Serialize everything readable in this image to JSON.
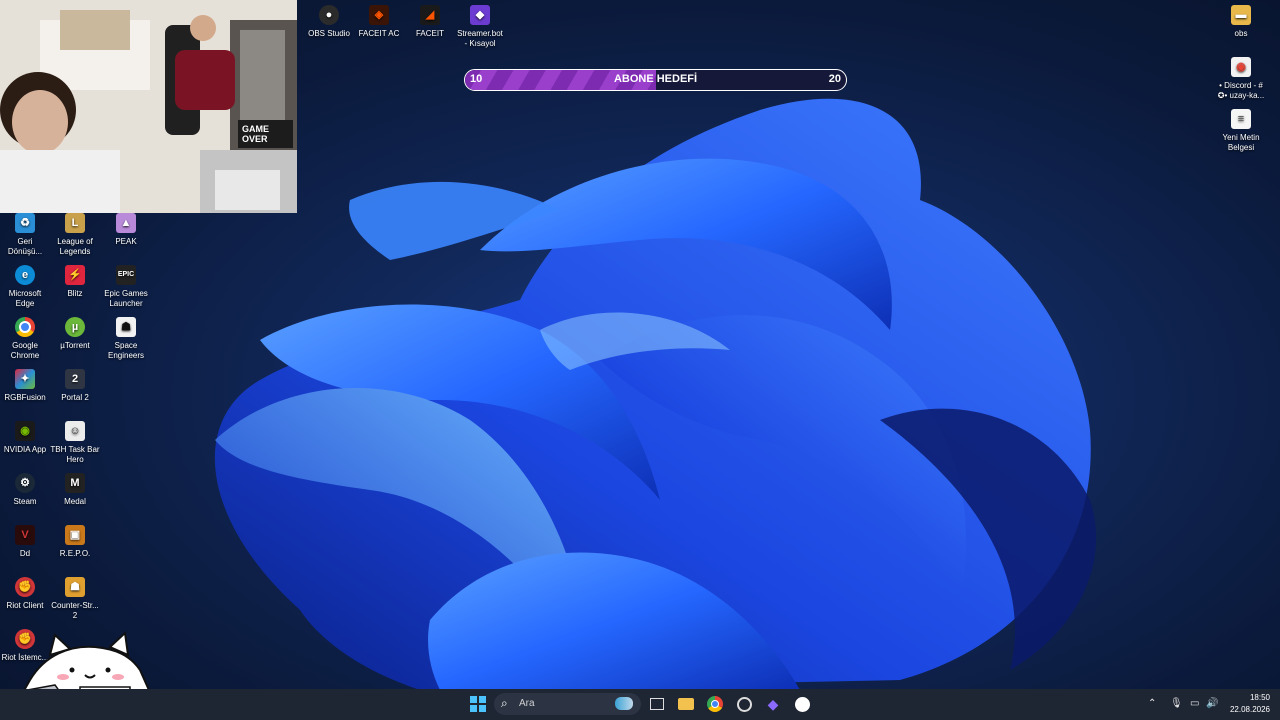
{
  "desktop": {
    "top_icons": [
      {
        "label": "OBS Studio",
        "icon": "obs-icon",
        "color": "#2b2b2b"
      },
      {
        "label": "FACEIT AC",
        "icon": "faceit-ac-icon",
        "color": "#ff5500"
      },
      {
        "label": "FACEIT",
        "icon": "faceit-icon",
        "color": "#ff5500"
      },
      {
        "label": "Streamer.bot - Kısayol",
        "icon": "streamer-bot-icon",
        "color": "#6c3bd1"
      }
    ],
    "right_icons": [
      {
        "label": "obs",
        "icon": "folder-icon"
      },
      {
        "label": "• Discord - # ✪• uzay-ka...",
        "icon": "chrome-shortcut-icon"
      },
      {
        "label": "Yeni Metin Belgesi",
        "icon": "text-document-icon"
      }
    ],
    "left_icons": [
      {
        "label": "Geri Dönüşü...",
        "icon": "recycle-bin-icon",
        "color": "#2a8fd6"
      },
      {
        "label": "League of Legends",
        "icon": "league-icon",
        "color": "#c8a14a"
      },
      {
        "label": "PEAK",
        "icon": "peak-icon",
        "color": "#b88ad9"
      },
      {
        "label": "Microsoft Edge",
        "icon": "edge-icon",
        "color": "#0c8bd6"
      },
      {
        "label": "Blitz",
        "icon": "blitz-icon",
        "color": "#e0263f"
      },
      {
        "label": "Epic Games Launcher",
        "icon": "epic-games-icon",
        "color": "#222222"
      },
      {
        "label": "Google Chrome",
        "icon": "chrome-icon",
        "color": "#e84335"
      },
      {
        "label": "µTorrent",
        "icon": "utorrent-icon",
        "color": "#6bb83a"
      },
      {
        "label": "Space Engineers",
        "icon": "space-engineers-icon",
        "color": "#f2f2f2"
      },
      {
        "label": "RGBFusion",
        "icon": "rgbfusion-icon",
        "color": "#d2335f"
      },
      {
        "label": "Portal 2",
        "icon": "portal2-icon",
        "color": "#2f3542"
      },
      {
        "label": "NVIDIA App",
        "icon": "nvidia-icon",
        "color": "#76b900"
      },
      {
        "label": "TBH Task Bar Hero",
        "icon": "taskbar-hero-icon",
        "color": "#ececec"
      },
      {
        "label": "Steam",
        "icon": "steam-icon",
        "color": "#1b2838"
      },
      {
        "label": "Medal",
        "icon": "medal-icon",
        "color": "#222222"
      },
      {
        "label": "Dd",
        "icon": "dd-icon",
        "color": "#2a0b0b"
      },
      {
        "label": "R.E.P.O.",
        "icon": "repo-icon",
        "color": "#c9781a"
      },
      {
        "label": "Riot Client",
        "icon": "riot-client-icon",
        "color": "#d13639"
      },
      {
        "label": "Counter-Str... 2",
        "icon": "counter-strike-icon",
        "color": "#e0a030"
      },
      {
        "label": "Riot İstemc...",
        "icon": "riot-client-icon",
        "color": "#d13639"
      }
    ]
  },
  "webcam": {
    "overlay_text": "GAME OVER"
  },
  "goal": {
    "start": "10",
    "label": "ABONE HEDEFİ",
    "end": "20",
    "progress": 0.5
  },
  "taskbar": {
    "search_placeholder": "Ara",
    "pinned": [
      "windows-start-icon",
      "task-view-icon",
      "file-explorer-icon",
      "chrome-icon",
      "obs-icon",
      "streamer-bot-icon",
      "github-icon"
    ],
    "time": "18:50",
    "date": "22.08.2026"
  }
}
